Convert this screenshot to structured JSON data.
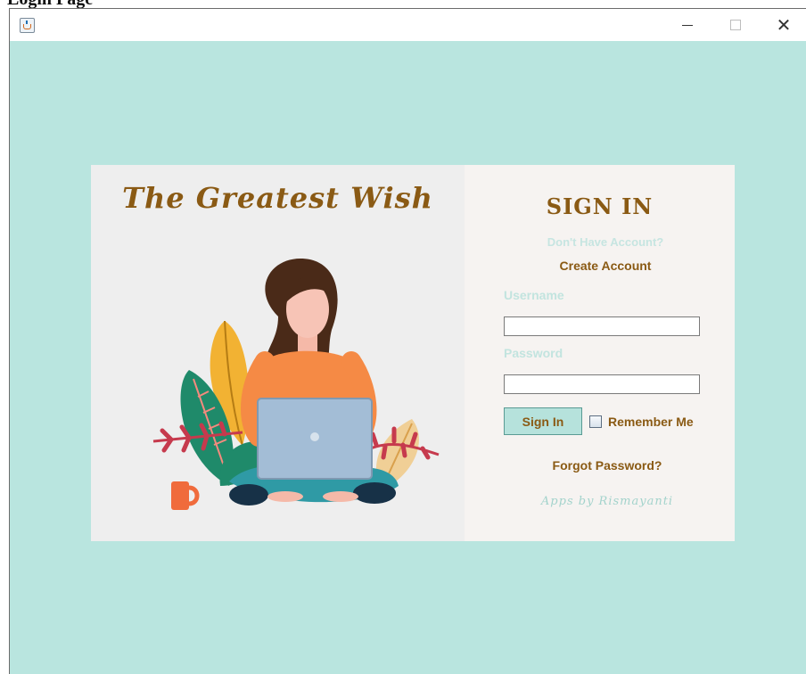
{
  "document": {
    "title": "Login Page"
  },
  "window": {
    "title": "",
    "icon": "java-cup-icon"
  },
  "brand": {
    "name": "The Greatest Wish"
  },
  "form": {
    "title": "SIGN IN",
    "no_account_text": "Don't Have Account?",
    "create_account_label": "Create Account",
    "username_label": "Username",
    "username_value": "",
    "password_label": "Password",
    "password_value": "",
    "signin_button_label": "Sign In",
    "remember_label": "Remember Me",
    "remember_checked": false,
    "forgot_label": "Forgot Password?",
    "credit": "Apps by Rismayanti"
  },
  "colors": {
    "background": "#b9e5df",
    "accent_brown": "#8a5a14",
    "muted_teal": "#c2e4df",
    "left_panel": "#eeeeee",
    "right_panel": "#f6f3f1"
  }
}
